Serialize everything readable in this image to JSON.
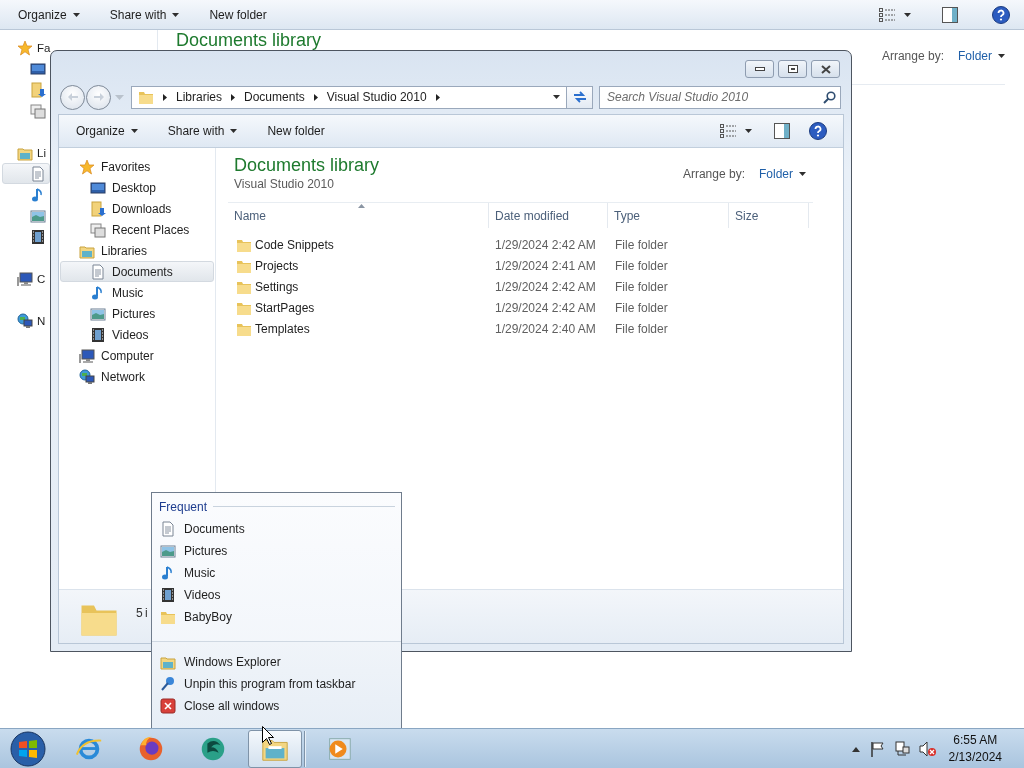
{
  "background_window": {
    "toolbar": [
      {
        "label": "Organize",
        "menu": true
      },
      {
        "label": "Share with",
        "menu": true
      },
      {
        "label": "New folder",
        "menu": false
      }
    ],
    "nav": [
      {
        "kind": "favorites",
        "label": "Fa",
        "selected": false
      },
      {
        "kind": "desktop",
        "selected": false
      },
      {
        "kind": "downloads",
        "selected": false
      },
      {
        "kind": "recent",
        "selected": false
      },
      {
        "kind": "libraries",
        "label": "Li",
        "selected": false
      },
      {
        "kind": "documents",
        "selected": true
      },
      {
        "kind": "music",
        "selected": false
      },
      {
        "kind": "pictures",
        "selected": false
      },
      {
        "kind": "videos",
        "selected": false
      },
      {
        "kind": "computer",
        "label": "C",
        "selected": false
      },
      {
        "kind": "network",
        "label": "N",
        "selected": false
      }
    ],
    "title": "Documents library",
    "arrange_label": "Arrange by:",
    "arrange_value": "Folder"
  },
  "window": {
    "address": [
      "Libraries",
      "Documents",
      "Visual Studio 2010"
    ],
    "search": {
      "placeholder": "Search Visual Studio 2010"
    },
    "toolbar": [
      {
        "label": "Organize",
        "menu": true
      },
      {
        "label": "Share with",
        "menu": true
      },
      {
        "label": "New folder",
        "menu": false
      }
    ],
    "nav": [
      {
        "kind": "favorites",
        "label": "Favorites",
        "selected": false,
        "children": [
          {
            "kind": "desktop",
            "label": "Desktop",
            "selected": false
          },
          {
            "kind": "downloads",
            "label": "Downloads",
            "selected": false
          },
          {
            "kind": "recent",
            "label": "Recent Places",
            "selected": false
          }
        ]
      },
      {
        "kind": "libraries",
        "label": "Libraries",
        "selected": false,
        "children": [
          {
            "kind": "documents",
            "label": "Documents",
            "selected": true
          },
          {
            "kind": "music",
            "label": "Music",
            "selected": false
          },
          {
            "kind": "pictures",
            "label": "Pictures",
            "selected": false
          },
          {
            "kind": "videos",
            "label": "Videos",
            "selected": false
          }
        ]
      },
      {
        "kind": "computer",
        "label": "Computer",
        "selected": false
      },
      {
        "kind": "network",
        "label": "Network",
        "selected": false
      }
    ],
    "title": "Documents library",
    "subtitle": "Visual Studio 2010",
    "arrange_label": "Arrange by:",
    "arrange_value": "Folder",
    "columns": [
      {
        "label": "Name",
        "sorted": true
      },
      {
        "label": "Date modified",
        "sorted": false
      },
      {
        "label": "Type",
        "sorted": false
      },
      {
        "label": "Size",
        "sorted": false
      }
    ],
    "rows": [
      {
        "name": "Code Snippets",
        "date": "1/29/2024 2:42 AM",
        "type": "File folder"
      },
      {
        "name": "Projects",
        "date": "1/29/2024 2:41 AM",
        "type": "File folder"
      },
      {
        "name": "Settings",
        "date": "1/29/2024 2:42 AM",
        "type": "File folder"
      },
      {
        "name": "StartPages",
        "date": "1/29/2024 2:42 AM",
        "type": "File folder"
      },
      {
        "name": "Templates",
        "date": "1/29/2024 2:40 AM",
        "type": "File folder"
      }
    ],
    "status": "5 i"
  },
  "jump_list": {
    "heading": "Frequent",
    "frequent": [
      {
        "kind": "documents",
        "label": "Documents"
      },
      {
        "kind": "pictures",
        "label": "Pictures"
      },
      {
        "kind": "music",
        "label": "Music"
      },
      {
        "kind": "videos",
        "label": "Videos"
      },
      {
        "kind": "folder",
        "label": "BabyBoy"
      }
    ],
    "tasks": [
      {
        "kind": "explorer",
        "label": "Windows Explorer"
      },
      {
        "kind": "pin",
        "label": "Unpin this program from taskbar"
      },
      {
        "kind": "close",
        "label": "Close all windows"
      }
    ]
  },
  "taskbar": {
    "apps": [
      {
        "kind": "ie",
        "active": false
      },
      {
        "kind": "firefox",
        "active": false
      },
      {
        "kind": "sphere",
        "active": false
      },
      {
        "kind": "explorer",
        "active": true
      },
      {
        "kind": "media",
        "active": false
      }
    ],
    "time": "6:55 AM",
    "date": "2/13/2024"
  }
}
